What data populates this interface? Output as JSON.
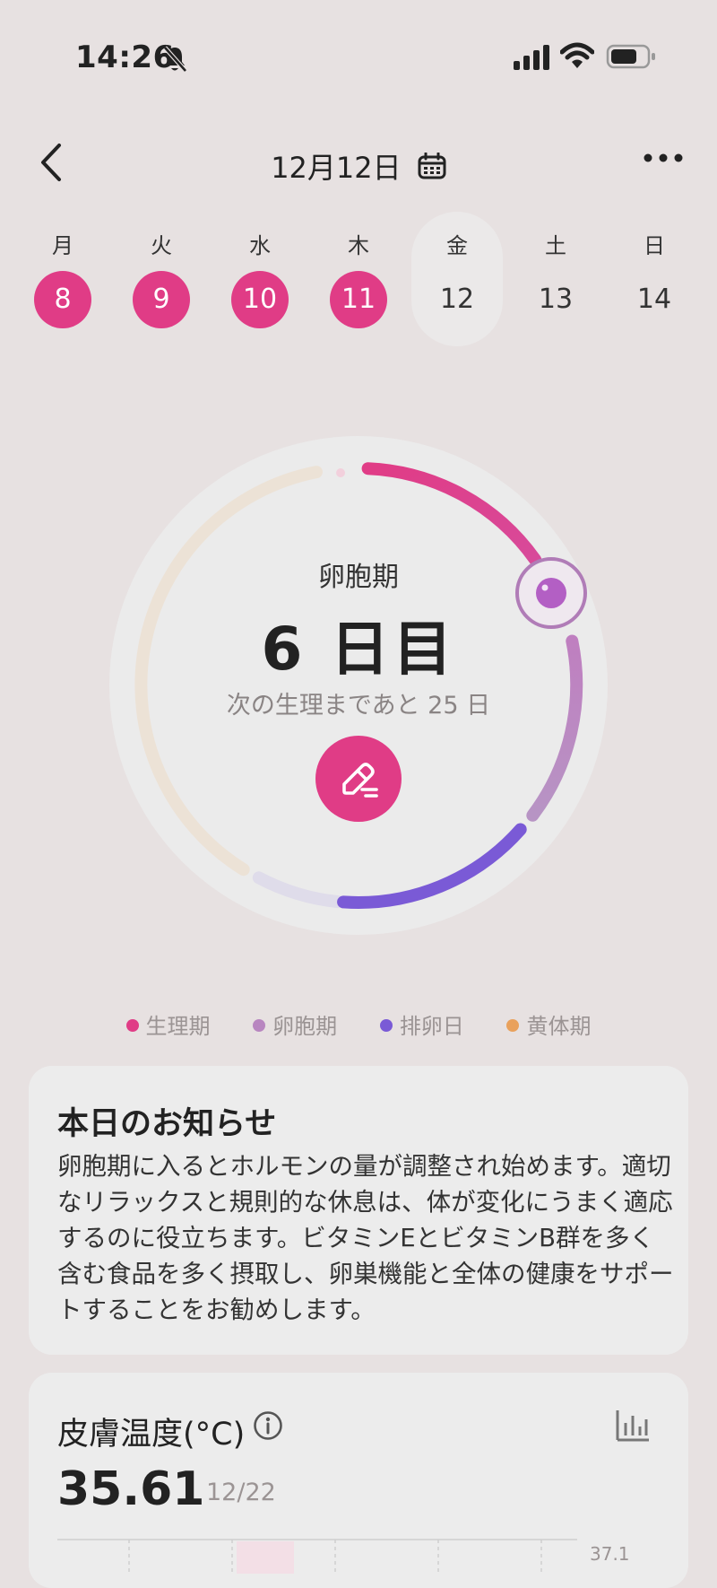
{
  "status_bar": {
    "time": "14:26"
  },
  "header": {
    "date": "12月12日"
  },
  "week": [
    {
      "name": "月",
      "date": "8",
      "state": "period"
    },
    {
      "name": "火",
      "date": "9",
      "state": "period"
    },
    {
      "name": "水",
      "date": "10",
      "state": "period"
    },
    {
      "name": "木",
      "date": "11",
      "state": "period"
    },
    {
      "name": "金",
      "date": "12",
      "state": "today"
    },
    {
      "name": "土",
      "date": "13",
      "state": "normal"
    },
    {
      "name": "日",
      "date": "14",
      "state": "normal"
    }
  ],
  "cycle": {
    "phase": "卵胞期",
    "day_label": "6 日目",
    "next_period": "次の生理まであと 25 日"
  },
  "legend": [
    {
      "label": "生理期",
      "color": "#e03c86"
    },
    {
      "label": "卵胞期",
      "color": "#b886c0"
    },
    {
      "label": "排卵日",
      "color": "#7a5ad6"
    },
    {
      "label": "黄体期",
      "color": "#e9a15c"
    }
  ],
  "notice": {
    "title": "本日のお知らせ",
    "body": "卵胞期に入るとホルモンの量が調整され始めます。適切なリラックスと規則的な休息は、体が変化にうまく適応するのに役立ちます。ビタミンEとビタミンB群を多く含む食品を多く摂取し、卵巣機能と全体の健康をサポートすることをお勧めします。"
  },
  "skin_temp": {
    "title": "皮膚温度(°C)",
    "value": "35.61",
    "date": "12/22",
    "axis_top": "37.1"
  },
  "colors": {
    "accent": "#e03c86",
    "background": "#e7e1e1"
  }
}
